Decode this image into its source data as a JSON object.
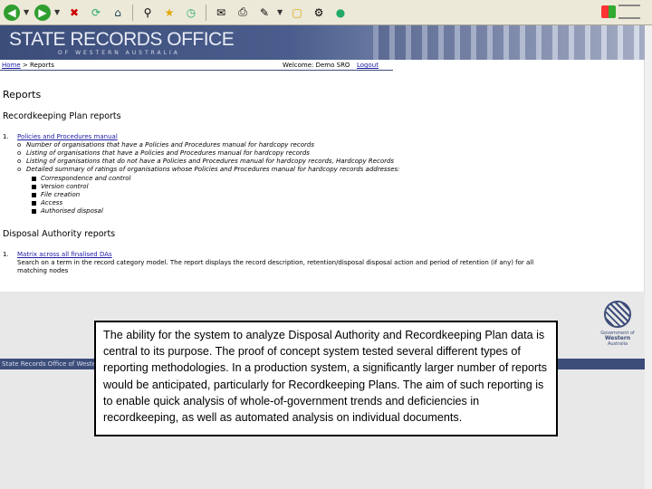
{
  "browser": {
    "toolbar_icons": [
      "back-icon",
      "forward-icon",
      "stop-icon",
      "refresh-icon",
      "home-icon",
      "search-icon",
      "favorites-icon",
      "history-icon",
      "mail-icon",
      "print-icon",
      "edit-icon",
      "folder-icon",
      "tools-icon",
      "messenger-icon"
    ]
  },
  "banner": {
    "title": "STATE RECORDS OFFICE",
    "subtitle": "OF WESTERN AUSTRALIA"
  },
  "nav": {
    "breadcrumb_home": "Home",
    "breadcrumb_sep": " > ",
    "breadcrumb_current": "Reports",
    "welcome": "Welcome: Demo SRO",
    "logout": "Logout"
  },
  "page": {
    "title": "Reports",
    "rk_section": "Recordkeeping Plan reports",
    "rk_item_num": "1.",
    "rk_item_link": "Policies and Procedures manual",
    "rk_subitems": [
      "Number of organisations that have a Policies and Procedures manual for hardcopy records",
      "Listing of organisations that have a Policies and Procedures manual for hardcopy records",
      "Listing of organisations that do not have a Policies and Procedures manual for hardcopy records, Hardcopy Records",
      "Detailed summary of ratings of organisations whose Policies and Procedures manual for hardcopy records addresses:"
    ],
    "rk_bullets": [
      "Correspondence and control",
      "Version control",
      "File creation",
      "Access",
      "Authorised disposal"
    ],
    "da_section": "Disposal Authority reports",
    "da_item_num": "1.",
    "da_item_link": "Matrix across all finalised DAs",
    "da_item_desc_1": "Search on a term in the record category model. The report displays the record description, retention/disposal disposal action and period of retention (if any) for all",
    "da_item_desc_2": "matching nodes"
  },
  "footer": {
    "text": "State Records Office of Western Australia",
    "gov_logo_line1": "Government of",
    "gov_logo_line2": "Western",
    "gov_logo_line3": "Australia"
  },
  "caption": {
    "text": "The ability for the system to analyze Disposal Authority and Recordkeeping Plan data is central to its purpose. The proof of concept system tested several different types of reporting methodologies. In a production system, a significantly larger number of reports would be anticipated, particularly for Recordkeeping Plans. The aim of such reporting is to enable quick analysis of whole-of-government trends and deficiencies in recordkeeping, as well as automated analysis on individual documents."
  }
}
